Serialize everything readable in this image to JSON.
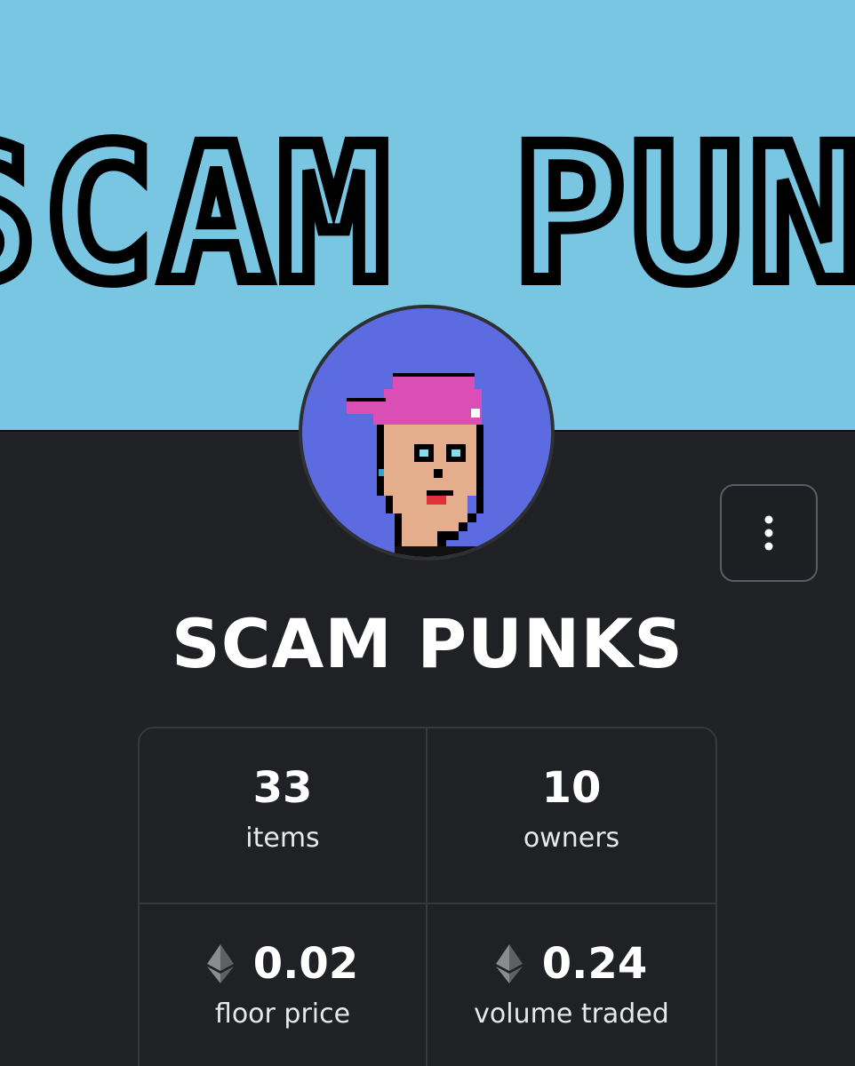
{
  "banner": {
    "text": "SCAM PUNKS"
  },
  "avatar": {
    "icon": "pixel-punk-avatar",
    "background_color": "#5d6be0"
  },
  "actions": {
    "more_icon": "vertical-ellipsis-icon"
  },
  "collection": {
    "title": "SCAM PUNKS"
  },
  "stats": {
    "items": {
      "value": "33",
      "label": "items"
    },
    "owners": {
      "value": "10",
      "label": "owners"
    },
    "floor_price": {
      "value": "0.02",
      "label": "floor price",
      "icon": "ethereum-icon"
    },
    "volume_traded": {
      "value": "0.24",
      "label": "volume traded",
      "icon": "ethereum-icon"
    }
  },
  "colors": {
    "banner_bg": "#79c6e2",
    "page_bg": "#202124",
    "text": "#ffffff",
    "border": "#36383c"
  }
}
